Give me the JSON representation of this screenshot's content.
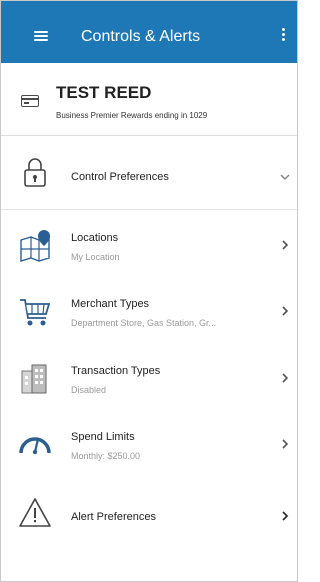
{
  "header": {
    "title": "Controls & Alerts",
    "menu_icon": "hamburger-menu-icon",
    "more_icon": "more-vertical-icon",
    "color": "#1f78b6"
  },
  "account": {
    "name": "TEST REED",
    "description": "Business Premier Rewards ending in 1029",
    "icon": "card-icon"
  },
  "items": [
    {
      "label": "Control Preferences",
      "sub": "",
      "icon": "lock-icon",
      "chevron": "chevron-down-icon"
    },
    {
      "label": "Locations",
      "sub": "My Location",
      "icon": "map-pin-icon",
      "chevron": "chevron-right-icon"
    },
    {
      "label": "Merchant Types",
      "sub": "Department Store, Gas Station, Gr...",
      "icon": "shopping-cart-icon",
      "chevron": "chevron-right-icon"
    },
    {
      "label": "Transaction Types",
      "sub": "Disabled",
      "icon": "buildings-icon",
      "chevron": "chevron-right-icon"
    },
    {
      "label": "Spend Limits",
      "sub": "Monthly: $250.00",
      "icon": "speedometer-icon",
      "chevron": "chevron-right-icon"
    },
    {
      "label": "Alert Preferences",
      "sub": "",
      "icon": "warning-triangle-icon",
      "chevron": "chevron-right-icon"
    }
  ]
}
